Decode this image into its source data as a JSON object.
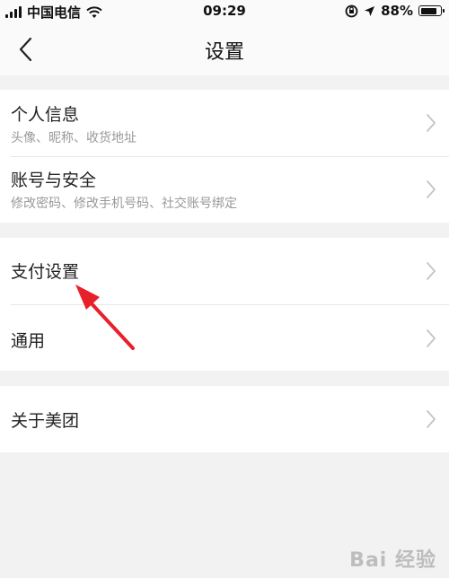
{
  "status_bar": {
    "carrier": "中国电信",
    "time": "09:29",
    "battery": "88%",
    "battery_level": 0.88
  },
  "nav": {
    "title": "设置"
  },
  "groups": [
    {
      "items": [
        {
          "title": "个人信息",
          "subtitle": "头像、昵称、收货地址"
        },
        {
          "title": "账号与安全",
          "subtitle": "修改密码、修改手机号码、社交账号绑定"
        }
      ]
    },
    {
      "items": [
        {
          "title": "支付设置"
        },
        {
          "title": "通用"
        }
      ]
    },
    {
      "items": [
        {
          "title": "关于美团"
        }
      ]
    }
  ],
  "annotation": {
    "color": "#e8202a"
  },
  "watermark": {
    "text": "Bai 经验"
  },
  "colors": {
    "background": "#f2f2f2",
    "card": "#ffffff",
    "subtitle": "#999999",
    "chevron": "#c4c4c4"
  }
}
